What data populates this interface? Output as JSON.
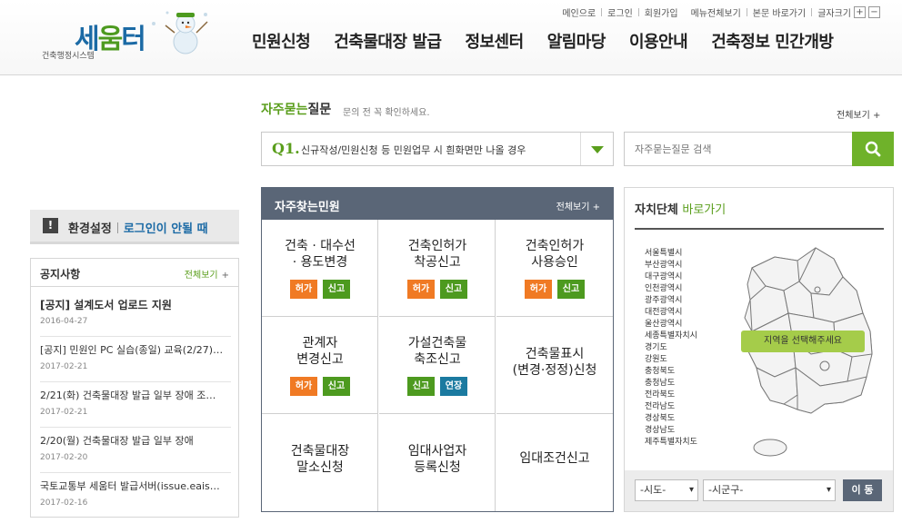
{
  "header": {
    "logo_sub": "건축행정시스템",
    "logo_main_1": "세",
    "logo_main_2": "움",
    "logo_main_3": "터",
    "util": {
      "main": "메인으로",
      "login": "로그인",
      "join": "회원가입",
      "sitemap": "메뉴전체보기",
      "skip": "본문 바로가기",
      "fontsize": "글자크기",
      "plus": "+",
      "minus": "−"
    },
    "nav": [
      "민원신청",
      "건축물대장 발급",
      "정보센터",
      "알림마당",
      "이용안내",
      "건축정보 민간개방"
    ]
  },
  "faq": {
    "title_green": "자주묻는",
    "title_rest": "질문",
    "desc": "문의 전 꼭 확인하세요.",
    "more": "전체보기 +",
    "q_label": "Q1.",
    "q_text": "신규작성/민원신청 등 민원업무 시 흰화면만 나올 경우",
    "search_placeholder": "자주묻는질문 검색"
  },
  "env": {
    "icon": "!",
    "label": "환경설정",
    "link": "로그인이 안될 때"
  },
  "notice": {
    "title": "공지사항",
    "more": "전체보기",
    "more_icon": "+",
    "items": [
      {
        "title": "[공지] 설계도서 업로드 지원",
        "date": "2016-04-27"
      },
      {
        "title": "[공지] 민원인 PC 실습(종일) 교육(2/27)…",
        "date": "2017-02-21"
      },
      {
        "title": "2/21(화) 건축물대장 발급 일부 장애 조…",
        "date": "2017-02-21"
      },
      {
        "title": "2/20(월) 건축물대장 발급 일부 장애",
        "date": "2017-02-20"
      },
      {
        "title": "국토교통부 세움터 발급서버(issue.eais…",
        "date": "2017-02-16"
      }
    ]
  },
  "services": {
    "title": "자주찾는민원",
    "more": "전체보기 +",
    "cells": [
      {
        "name": "건축 · 대수선\n· 용도변경",
        "tags": [
          {
            "label": "허가",
            "color": "orange"
          },
          {
            "label": "신고",
            "color": "green"
          }
        ]
      },
      {
        "name": "건축인허가\n착공신고",
        "tags": [
          {
            "label": "허가",
            "color": "orange"
          },
          {
            "label": "신고",
            "color": "green"
          }
        ]
      },
      {
        "name": "건축인허가\n사용승인",
        "tags": [
          {
            "label": "허가",
            "color": "orange"
          },
          {
            "label": "신고",
            "color": "green"
          }
        ]
      },
      {
        "name": "관계자\n변경신고",
        "tags": [
          {
            "label": "허가",
            "color": "orange"
          },
          {
            "label": "신고",
            "color": "green"
          }
        ]
      },
      {
        "name": "가설건축물\n축조신고",
        "tags": [
          {
            "label": "신고",
            "color": "green"
          },
          {
            "label": "연장",
            "color": "blue"
          }
        ]
      },
      {
        "name": "건축물표시\n(변경·정정)신청",
        "tags": []
      },
      {
        "name": "건축물대장\n말소신청",
        "tags": []
      },
      {
        "name": "임대사업자\n등록신청",
        "tags": []
      },
      {
        "name": "임대조건신고",
        "tags": []
      }
    ]
  },
  "gov": {
    "title": "자치단체",
    "title_green": "바로가기",
    "regions": [
      "서울특별시",
      "부산광역시",
      "대구광역시",
      "인천광역시",
      "광주광역시",
      "대전광역시",
      "울산광역시",
      "세종특별자치시",
      "경기도",
      "강원도",
      "충청북도",
      "충청남도",
      "전라북도",
      "전라남도",
      "경상북도",
      "경상남도",
      "제주특별자치도"
    ],
    "map_button": "지역을 선택해주세요",
    "select_sido": "-시도-",
    "select_sigungu": "-시군구-",
    "go": "이 동"
  },
  "colors": {
    "green": "#5a9e1c",
    "blue": "#1b6aa5",
    "orange": "#f07a24",
    "slate": "#5a6677",
    "search": "#6fb22a"
  }
}
